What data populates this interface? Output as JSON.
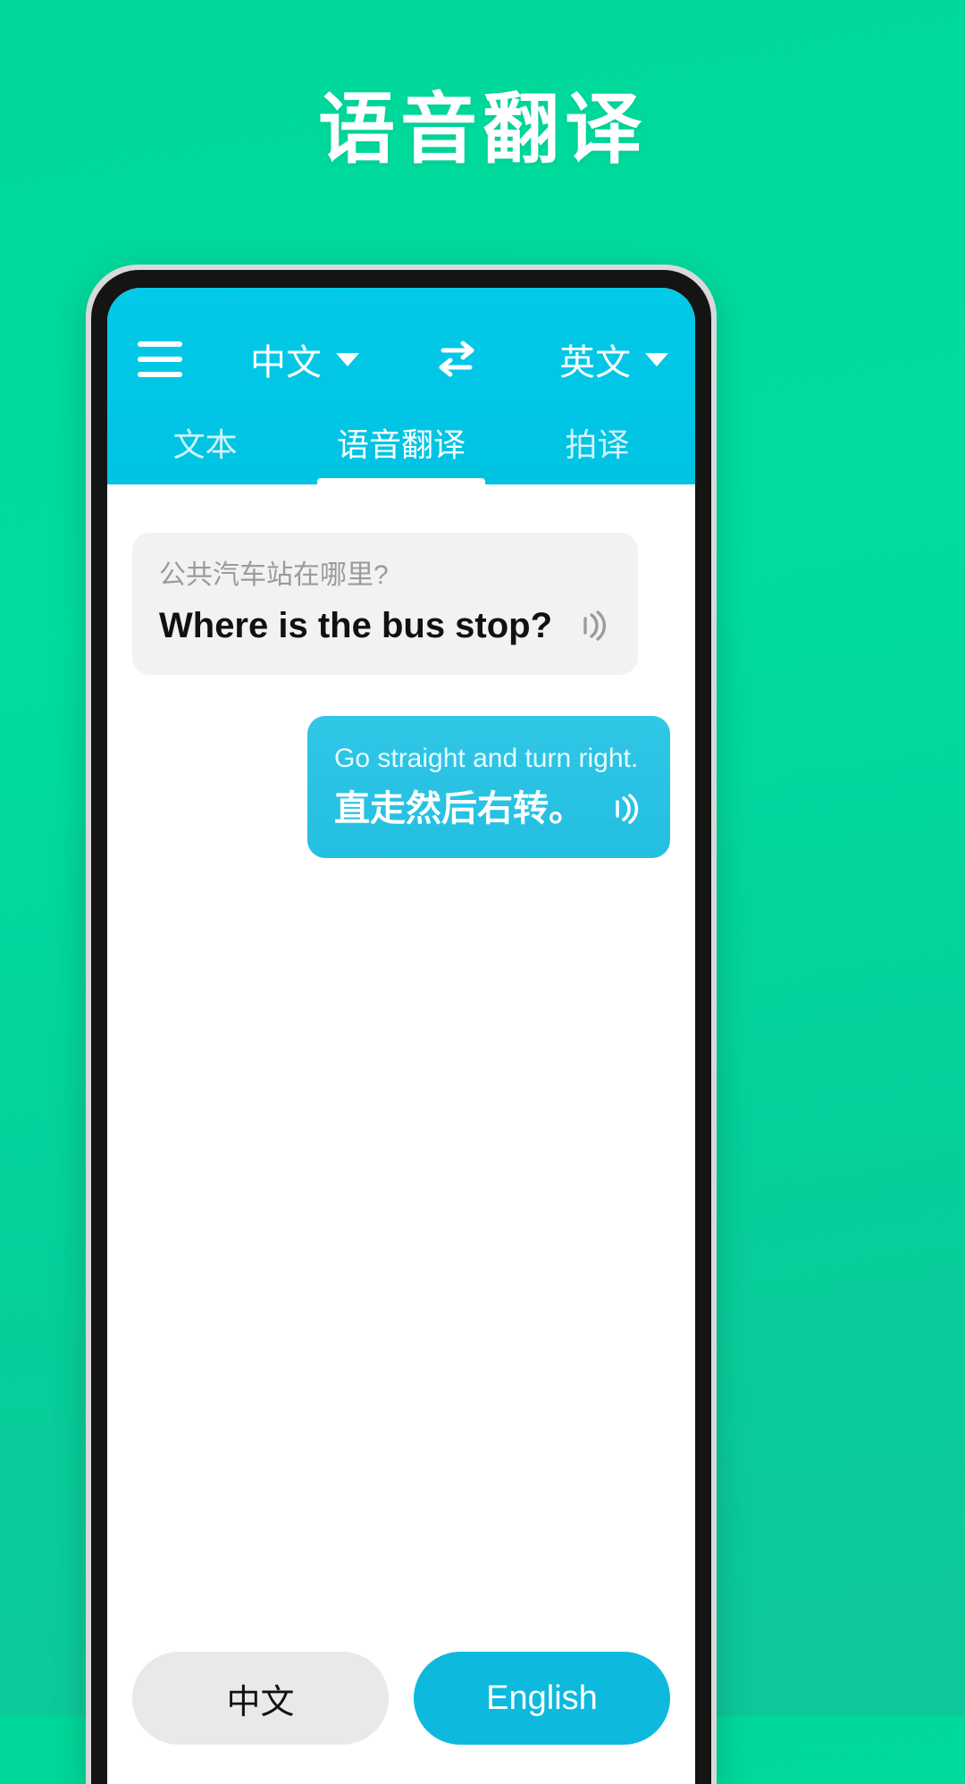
{
  "page": {
    "headline": "语音翻译",
    "background_color": "#00d79a"
  },
  "appbar": {
    "menu_icon": "hamburger-menu-icon",
    "source_language": "中文",
    "swap_icon": "swap-arrows-icon",
    "target_language": "英文",
    "accent_color": "#00c6e6"
  },
  "tabs": [
    {
      "label": "文本",
      "active": false
    },
    {
      "label": "语音翻译",
      "active": true
    },
    {
      "label": "拍译",
      "active": false
    }
  ],
  "conversation": [
    {
      "side": "left",
      "style": "gray",
      "secondary_text": "公共汽车站在哪里?",
      "primary_text": "Where is the bus stop?",
      "speaker_icon": "speaker-sound-icon"
    },
    {
      "side": "right",
      "style": "blue",
      "secondary_text": "Go straight and turn right.",
      "primary_text": "直走然后右转。",
      "speaker_icon": "speaker-sound-icon"
    }
  ],
  "bottom_bar": {
    "left_button": "中文",
    "right_button": "English",
    "left_color": "#e9e9e9",
    "right_color": "#0db9dd"
  }
}
